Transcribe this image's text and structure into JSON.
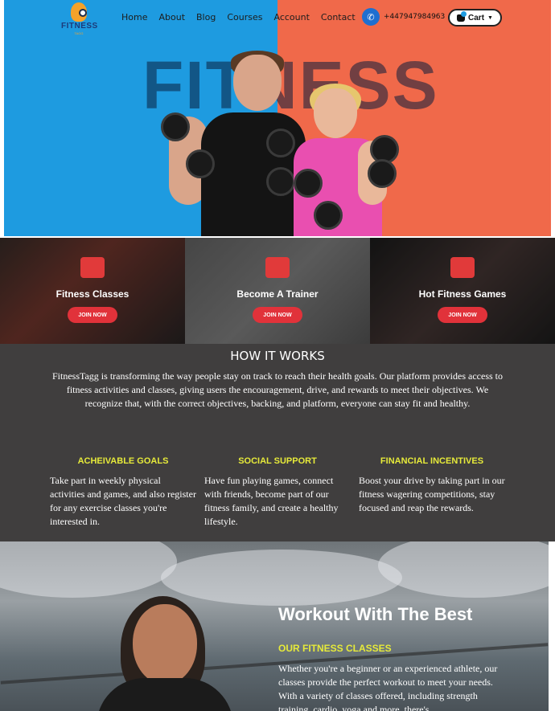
{
  "nav": {
    "logo_text": "FITNESS",
    "logo_sub": "TAGG",
    "menu": [
      {
        "label": "Home"
      },
      {
        "label": "About"
      },
      {
        "label": "Blog"
      },
      {
        "label": "Courses"
      },
      {
        "label": "Account"
      },
      {
        "label": "Contact"
      }
    ],
    "phone": "+447947984963",
    "cart_label": "Cart"
  },
  "hero": {
    "big_word": "FITNESS",
    "colors": {
      "left": "#1e9be0",
      "right": "#f0694a"
    }
  },
  "tiles": [
    {
      "title": "Fitness Classes",
      "button": "JOIN NOW",
      "icon": "fitness-icon"
    },
    {
      "title": "Become A Trainer",
      "button": "JOIN NOW",
      "icon": "trainer-icon"
    },
    {
      "title": "Hot Fitness Games",
      "button": "JOIN NOW",
      "icon": "stopwatch-icon"
    }
  ],
  "how": {
    "title": "HOW IT WORKS",
    "description": "FitnessTagg is transforming the way people stay on track to reach their health goals. Our platform provides access to fitness activities and classes, giving users the encouragement, drive, and rewards to meet their objectives. We recognize that, with the correct objectives, backing, and platform, everyone can stay fit and healthy.",
    "columns": [
      {
        "title": "ACHEIVABLE GOALS",
        "text": "Take part in weekly physical activities and games, and also register for any exercise classes you're interested in."
      },
      {
        "title": "SOCIAL SUPPORT",
        "text": "Have fun playing games, connect with friends, become part of our fitness family, and create a healthy lifestyle."
      },
      {
        "title": "FINANCIAL INCENTIVES",
        "text": "Boost your drive by taking part in our fitness wagering competitions, stay focused and reap the rewards."
      }
    ]
  },
  "workout": {
    "title": "Workout With The Best",
    "subtitle": "OUR FITNESS CLASSES",
    "description": "Whether you're a beginner or an experienced athlete, our  classes provide the perfect workout to meet your needs. With a variety of classes offered, including strength training, cardio, yoga and more, there's"
  },
  "colors": {
    "accent_red": "#e1323a",
    "accent_yellow": "#e6ea3a",
    "dark_bg": "#403e3e"
  }
}
